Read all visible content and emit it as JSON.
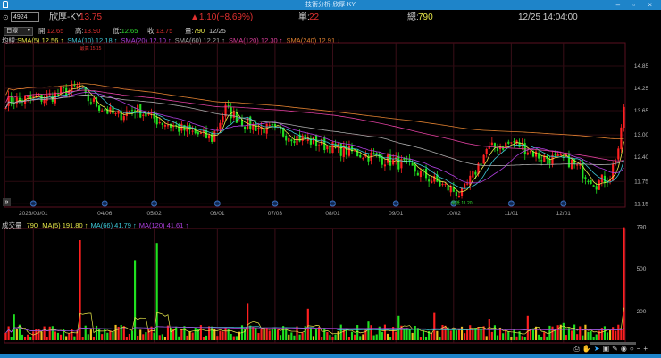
{
  "window": {
    "title": "技術分析-欣厚-KY"
  },
  "header": {
    "code": "4924",
    "name": "欣厚-KY",
    "price": "13.75",
    "change": "▲1.10(+8.69%)",
    "single_label": "單:",
    "single_value": "22",
    "total_label": "總:",
    "total_value": "790",
    "datetime": "12/25 14:04:00"
  },
  "ohlc": {
    "period": "日線",
    "open_label": "開:",
    "open": "12.65",
    "high_label": "高:",
    "high": "13.90",
    "low_label": "低:",
    "low": "12.65",
    "close_label": "收:",
    "close": "13.75",
    "vol_label": "量:",
    "vol": "790",
    "date": "12/25"
  },
  "ma_legend": {
    "label": "均線:",
    "items": [
      {
        "text": "SMA(5) 12.56 ↑",
        "color": "#e8e84a"
      },
      {
        "text": "SMA(10) 12.18 ↑",
        "color": "#3fc8d8"
      },
      {
        "text": "SMA(20) 12.10 ↑",
        "color": "#b040e0"
      },
      {
        "text": "SMA(60) 12.21 ↑",
        "color": "#aaaaaa"
      },
      {
        "text": "SMA(120) 12.30 ↑",
        "color": "#e040a0"
      },
      {
        "text": "SMA(240) 12.91 ↓",
        "color": "#e08030"
      }
    ]
  },
  "annotations": {
    "high_mark": "最高 15.15",
    "low_mark": "最低 11.20"
  },
  "volume_legend": {
    "label": "成交量",
    "value": "790",
    "items": [
      {
        "text": "MA(5) 191.80 ↑",
        "color": "#e8e84a"
      },
      {
        "text": "MA(66) 41.79 ↑",
        "color": "#3fc8d8"
      },
      {
        "text": "MA(120) 41.61 ↑",
        "color": "#b040e0"
      }
    ]
  },
  "toolbar": {
    "icons": [
      "print-icon",
      "hand-icon",
      "cursor-icon",
      "zoom-box-icon",
      "draw-icon",
      "eye-icon",
      "refresh-icon",
      "zoom-out-icon",
      "zoom-in-icon"
    ]
  },
  "chart_data": {
    "type": "candlestick",
    "price_ticks": [
      "14.85",
      "14.25",
      "13.65",
      "13.00",
      "12.40",
      "11.75",
      "11.15"
    ],
    "price_tick_values": [
      14.85,
      14.25,
      13.65,
      13.0,
      12.4,
      11.75,
      11.15
    ],
    "volume_ticks": [
      "790",
      "500",
      "200"
    ],
    "volume_tick_values": [
      790,
      500,
      200
    ],
    "date_labels": [
      "2023/03/01",
      "04/06",
      "05/02",
      "06/01",
      "07/03",
      "08/01",
      "09/01",
      "10/02",
      "11/01",
      "12/01"
    ],
    "date_label_index": [
      10,
      36,
      54,
      77,
      98,
      119,
      142,
      163,
      184,
      203
    ],
    "close_anchors_index": [
      0,
      15,
      27,
      29,
      40,
      47,
      55,
      62,
      75,
      80,
      87,
      98,
      108,
      122,
      135,
      145,
      155,
      160,
      166,
      170,
      175,
      185,
      195,
      205,
      215,
      220,
      223,
      225
    ],
    "close_anchors": [
      13.9,
      14.0,
      14.3,
      14.0,
      13.5,
      13.7,
      13.4,
      13.2,
      12.9,
      13.7,
      13.3,
      13.1,
      12.9,
      12.6,
      12.4,
      12.2,
      11.8,
      11.6,
      11.4,
      11.9,
      12.6,
      12.8,
      12.4,
      12.3,
      11.7,
      11.9,
      12.65,
      13.75
    ],
    "volume_spikes_index": [
      3,
      27,
      47,
      55,
      88,
      110,
      132,
      143,
      156,
      176,
      190,
      203,
      225
    ],
    "volume_spikes": [
      180,
      700,
      560,
      680,
      260,
      220,
      130,
      170,
      190,
      150,
      170,
      120,
      790
    ],
    "ylim_price": [
      11.15,
      14.85
    ],
    "ylim_volume": [
      0,
      790
    ]
  }
}
